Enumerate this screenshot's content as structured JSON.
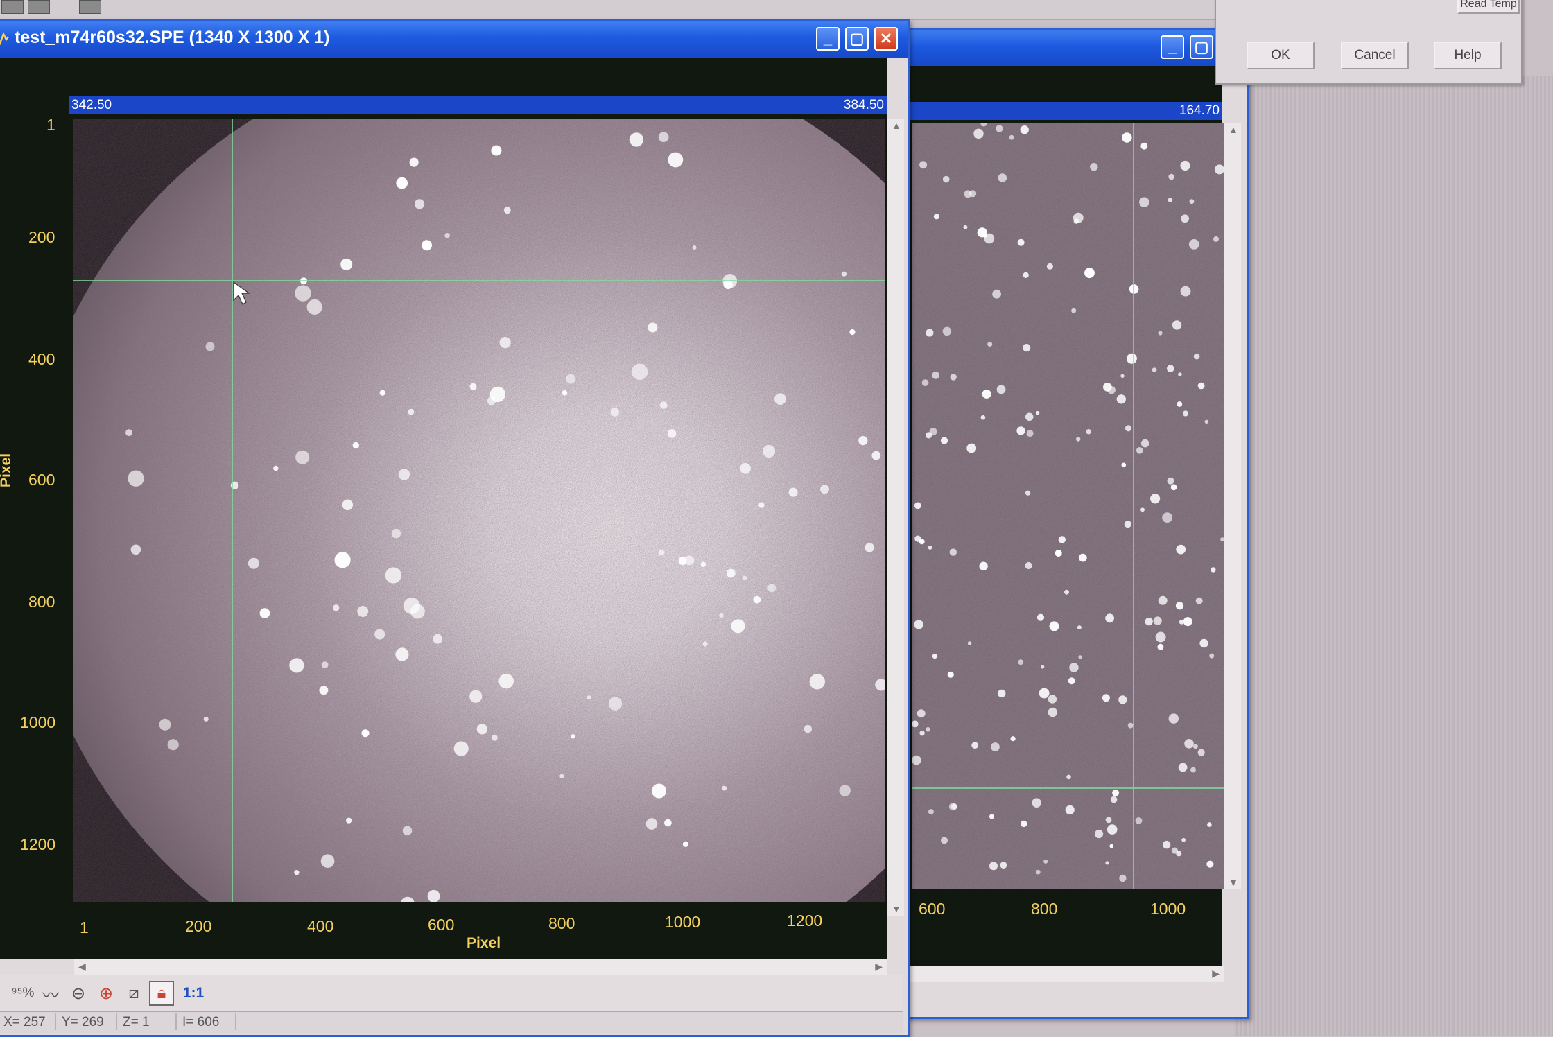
{
  "dialog": {
    "read_temp_label": "Read Temp",
    "ok_label": "OK",
    "cancel_label": "Cancel",
    "help_label": "Help"
  },
  "main_window": {
    "title": "test_m74r60s32.SPE (1340 X 1300 X 1)",
    "range_min": "342.50",
    "range_max": "384.50",
    "y_ticks": [
      "1",
      "200",
      "400",
      "600",
      "800",
      "1000",
      "1200"
    ],
    "x_ticks": [
      "1",
      "200",
      "400",
      "600",
      "800",
      "1000",
      "1200"
    ],
    "y_axis_label": "Pixel",
    "x_axis_label": "Pixel",
    "zoom_label": "1:1",
    "status": {
      "x": "X= 257",
      "y": "Y= 269",
      "z": "Z= 1",
      "i": "I= 606"
    },
    "colors": {
      "titlebar": "#1d5ae0",
      "range_bar": "#1b46c8",
      "tick_text": "#f3d060",
      "crosshair": "#7fe0a0"
    },
    "icons": [
      "histogram-icon",
      "line-profile-icon",
      "zoom-out-icon",
      "zoom-in-icon",
      "zoom-fit-icon",
      "lock-icon"
    ]
  },
  "second_window": {
    "range_max": "164.70",
    "x_ticks": [
      "600",
      "800",
      "1000"
    ]
  }
}
